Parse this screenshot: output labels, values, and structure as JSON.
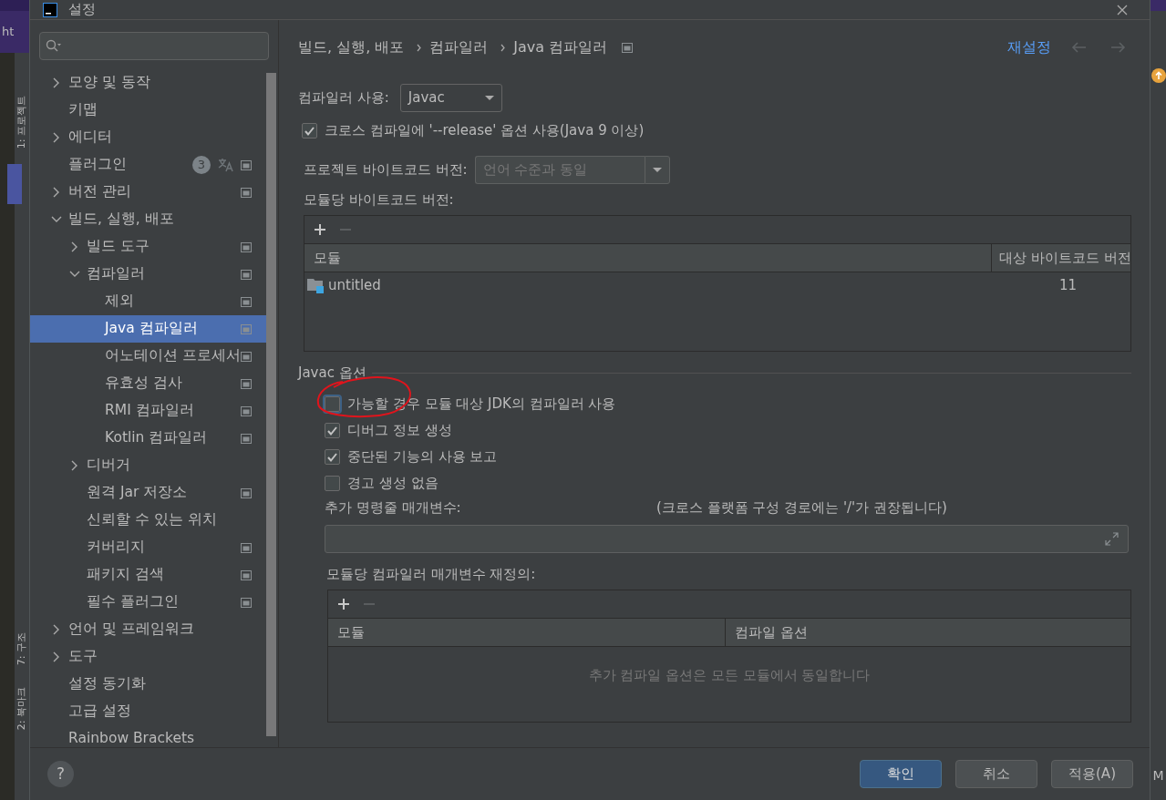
{
  "background": {
    "left_top_text": "ht",
    "left_tool_windows": [
      "1: 프로젝트",
      "7: 구조",
      "2: 북마크"
    ],
    "right_text": "M"
  },
  "window": {
    "title": "설정"
  },
  "sidebar": {
    "items": [
      {
        "label": "모양 및 동작",
        "expanded": false,
        "selected": false,
        "project_scope": false
      },
      {
        "label": "키맵",
        "selected": false,
        "project_scope": false
      },
      {
        "label": "에디터",
        "expanded": false,
        "selected": false,
        "project_scope": false
      },
      {
        "label": "플러그인",
        "selected": false,
        "project_scope": true,
        "badge": "3",
        "translate_icon": true
      },
      {
        "label": "버전 관리",
        "expanded": false,
        "selected": false,
        "project_scope": true
      },
      {
        "label": "빌드, 실행, 배포",
        "expanded": true,
        "selected": false,
        "project_scope": false,
        "children": [
          {
            "label": "빌드 도구",
            "expanded": false,
            "selected": false,
            "project_scope": true
          },
          {
            "label": "컴파일러",
            "expanded": true,
            "selected": false,
            "project_scope": true,
            "children": [
              {
                "label": "제외",
                "selected": false,
                "project_scope": true
              },
              {
                "label": "Java 컴파일러",
                "selected": true,
                "project_scope": true
              },
              {
                "label": "어노테이션 프로세서",
                "selected": false,
                "project_scope": true
              },
              {
                "label": "유효성 검사",
                "selected": false,
                "project_scope": true
              },
              {
                "label": "RMI 컴파일러",
                "selected": false,
                "project_scope": true
              },
              {
                "label": "Kotlin 컴파일러",
                "selected": false,
                "project_scope": true
              }
            ]
          },
          {
            "label": "디버거",
            "expanded": false,
            "selected": false,
            "project_scope": false
          },
          {
            "label": "원격 Jar 저장소",
            "selected": false,
            "project_scope": true
          },
          {
            "label": "신뢰할 수 있는 위치",
            "selected": false,
            "project_scope": false
          },
          {
            "label": "커버리지",
            "selected": false,
            "project_scope": true
          },
          {
            "label": "패키지 검색",
            "selected": false,
            "project_scope": true
          },
          {
            "label": "필수 플러그인",
            "selected": false,
            "project_scope": true
          }
        ]
      },
      {
        "label": "언어 및 프레임워크",
        "expanded": false,
        "selected": false,
        "project_scope": false
      },
      {
        "label": "도구",
        "expanded": false,
        "selected": false,
        "project_scope": false
      },
      {
        "label": "설정 동기화",
        "selected": false,
        "project_scope": false
      },
      {
        "label": "고급 설정",
        "selected": false,
        "project_scope": false
      },
      {
        "label": "Rainbow Brackets",
        "selected": false,
        "project_scope": false
      }
    ]
  },
  "breadcrumb": [
    "빌드, 실행, 배포",
    "컴파일러",
    "Java 컴파일러"
  ],
  "reset_link": "재설정",
  "compiler": {
    "label": "컴파일러 사용:",
    "value": "Javac"
  },
  "release_option": {
    "label": "크로스 컴파일에 '--release' 옵션 사용(Java 9 이상)",
    "checked": true
  },
  "project_bytecode": {
    "label": "프로젝트 바이트코드 버전:",
    "placeholder": "언어 수준과 동일"
  },
  "module_bytecode": {
    "label": "모듈당 바이트코드 버전:",
    "columns": [
      "모듈",
      "대상 바이트코드 버전"
    ],
    "rows": [
      {
        "module": "untitled",
        "version": "11"
      }
    ]
  },
  "javac_options": {
    "title": "Javac 옵션",
    "checkboxes": [
      {
        "label": "가능할 경우 모듈 대상 JDK의 컴파일러 사용",
        "checked": false,
        "focused": true
      },
      {
        "label": "디버그 정보 생성",
        "checked": true,
        "focused": false
      },
      {
        "label": "중단된 기능의 사용 보고",
        "checked": true,
        "focused": false
      },
      {
        "label": "경고 생성 없음",
        "checked": false,
        "focused": false
      }
    ],
    "params_label": "추가 명령줄 매개변수:",
    "params_hint": "(크로스 플랫폼 구성 경로에는 '/'가 권장됩니다)",
    "override_label": "모듈당 컴파일러 매개변수 재정의:",
    "override_columns": [
      "모듈",
      "컴파일 옵션"
    ],
    "override_empty": "추가 컴파일 옵션은 모든 모듈에서 동일합니다"
  },
  "annotation": {
    "kind": "circle"
  },
  "footer": {
    "help": "?",
    "buttons": [
      {
        "label": "확인",
        "kind": "primary"
      },
      {
        "label": "취소",
        "kind": "default"
      },
      {
        "label": "적용(A)",
        "kind": "default"
      }
    ]
  }
}
